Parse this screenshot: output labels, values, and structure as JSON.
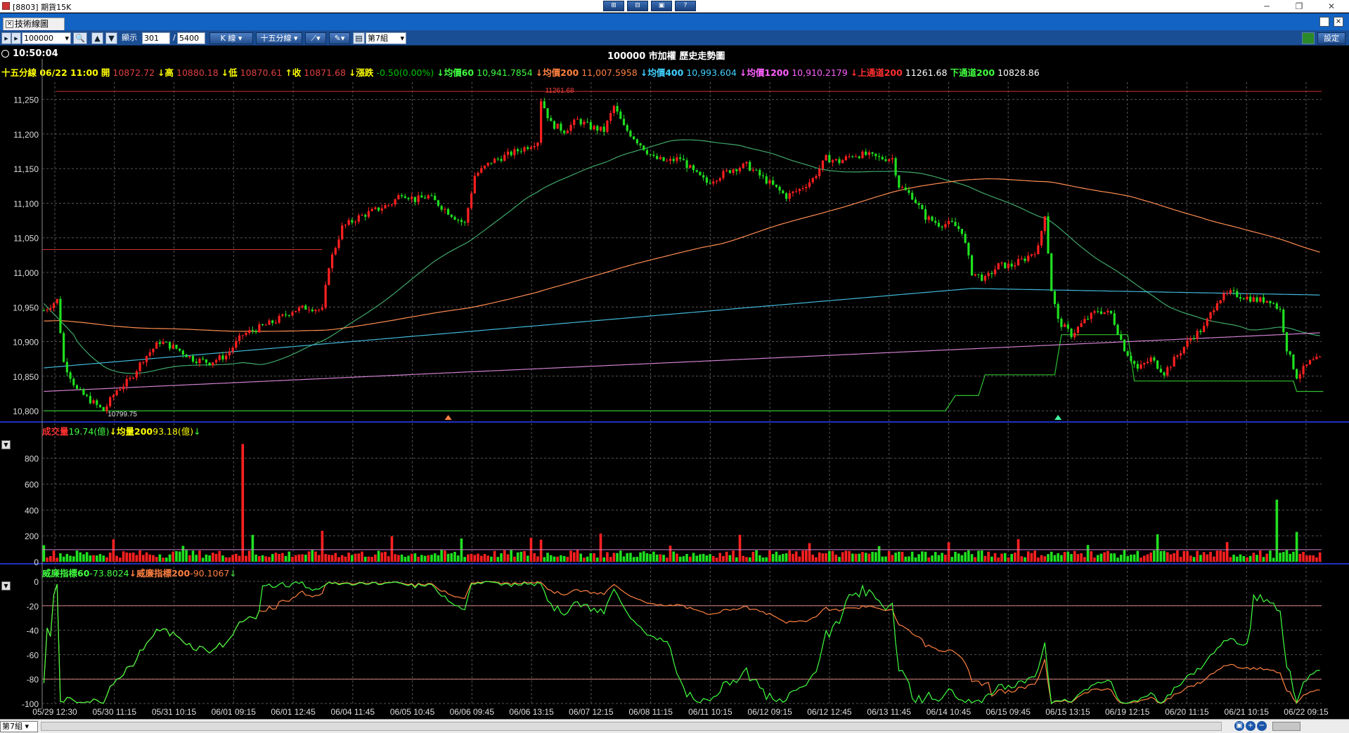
{
  "window": {
    "title": "[8803] 期貨15K",
    "toolbar_buttons": [
      "⊞",
      "⊟",
      "▣",
      "?"
    ],
    "min": "─",
    "restore": "❐",
    "close": "✕"
  },
  "tab": {
    "label": "技術線圖"
  },
  "toolbar": {
    "symbol": "100000",
    "display_label": "顯示",
    "display_count": "301",
    "slash": "/",
    "total_count": "5400",
    "kline": "K 線",
    "period": "十五分線",
    "group": "第7組",
    "settings": "設定"
  },
  "header": {
    "time": "10:50:04",
    "title": "100000 市加權   歷史走勢圖"
  },
  "info": [
    {
      "text": "十五分線 06/22 11:00",
      "color": "#ffff00",
      "bold": true
    },
    {
      "text": "開",
      "color": "#ffff00",
      "bold": true
    },
    {
      "text": "10872.72",
      "color": "#e04040"
    },
    {
      "text": "↓高",
      "color": "#ffff00",
      "bold": true
    },
    {
      "text": "10880.18",
      "color": "#e04040"
    },
    {
      "text": "↓低",
      "color": "#ffff00",
      "bold": true
    },
    {
      "text": "10870.61",
      "color": "#e04040"
    },
    {
      "text": "↑收",
      "color": "#ffff00",
      "bold": true
    },
    {
      "text": "10871.68",
      "color": "#e04040"
    },
    {
      "text": "↓漲跌",
      "color": "#ffff00",
      "bold": true
    },
    {
      "text": "-0.50(0.00%)",
      "color": "#00c800"
    },
    {
      "text": "↓均價60",
      "color": "#40ff40",
      "bold": true
    },
    {
      "text": "10,941.7854",
      "color": "#40ff40"
    },
    {
      "text": "↓均價200",
      "color": "#ff8040",
      "bold": true
    },
    {
      "text": "11,007.5958",
      "color": "#ff8040"
    },
    {
      "text": "↓均價400",
      "color": "#40d0ff",
      "bold": true
    },
    {
      "text": "10,993.604",
      "color": "#40d0ff"
    },
    {
      "text": "↓均價1200",
      "color": "#ff60ff",
      "bold": true
    },
    {
      "text": "10,910.2179",
      "color": "#ff60ff"
    },
    {
      "text": "↓上通道200",
      "color": "#ff3030",
      "bold": true
    },
    {
      "text": "11261.68",
      "color": "#ffffff"
    },
    {
      "text": "下通道200",
      "color": "#40ff40",
      "bold": true
    },
    {
      "text": "10828.86",
      "color": "#ffffff"
    }
  ],
  "volume_header": [
    {
      "text": "成交量",
      "color": "#ff3030",
      "bold": true
    },
    {
      "text": "19.74(億)",
      "color": "#40ff40"
    },
    {
      "text": "↓均量200",
      "color": "#ffff00",
      "bold": true
    },
    {
      "text": "93.18(億)",
      "color": "#ffff00"
    },
    {
      "text": "↓",
      "color": "#40ff40"
    }
  ],
  "williams_header": [
    {
      "text": "威廉指標60",
      "color": "#40ff40",
      "bold": true
    },
    {
      "text": "-73.8024",
      "color": "#40ff40"
    },
    {
      "text": "↓威廉指標200",
      "color": "#ff8040",
      "bold": true
    },
    {
      "text": "-90.1067",
      "color": "#ff8040"
    },
    {
      "text": "↓",
      "color": "#40ff40"
    }
  ],
  "chart_data": {
    "type": "candlestick",
    "price_axis": {
      "ticks": [
        "11,250",
        "11,200",
        "11,150",
        "11,100",
        "11,050",
        "11,000",
        "10,950",
        "10,900",
        "10,850",
        "10,800"
      ],
      "ylim": [
        10795,
        11275
      ]
    },
    "volume_axis": {
      "ticks": [
        "800",
        "600",
        "400",
        "200",
        "0"
      ],
      "ylim": [
        0,
        950
      ]
    },
    "williams_axis": {
      "ticks": [
        "0",
        "-20",
        "-40",
        "-60",
        "-80",
        "-100"
      ],
      "ylim": [
        -100,
        0
      ]
    },
    "x_ticks": [
      "05/29 12:30",
      "05/30 11:15",
      "05/31 10:15",
      "06/01 09:15",
      "06/01 12:45",
      "06/04 11:45",
      "06/05 10:45",
      "06/06 09:45",
      "06/06 13:15",
      "06/07 12:15",
      "06/08 11:15",
      "06/11 10:15",
      "06/12 09:15",
      "06/12 12:45",
      "06/13 11:45",
      "06/14 10:45",
      "06/15 09:45",
      "06/15 13:15",
      "06/19 12:15",
      "06/20 11:15",
      "06/21 10:15",
      "06/22 09:15"
    ],
    "annotations": {
      "high": "11261.68",
      "low": "10799.75"
    },
    "anchors": [
      [
        0,
        10945
      ],
      [
        4,
        10960
      ],
      [
        6,
        10870
      ],
      [
        10,
        10830
      ],
      [
        14,
        10815
      ],
      [
        18,
        10800
      ],
      [
        22,
        10830
      ],
      [
        26,
        10845
      ],
      [
        30,
        10875
      ],
      [
        35,
        10900
      ],
      [
        40,
        10890
      ],
      [
        45,
        10875
      ],
      [
        50,
        10870
      ],
      [
        55,
        10880
      ],
      [
        60,
        10910
      ],
      [
        65,
        10920
      ],
      [
        70,
        10930
      ],
      [
        75,
        10945
      ],
      [
        80,
        10950
      ],
      [
        84,
        10945
      ],
      [
        86,
        11010
      ],
      [
        90,
        11065
      ],
      [
        95,
        11080
      ],
      [
        100,
        11090
      ],
      [
        105,
        11100
      ],
      [
        108,
        11115
      ],
      [
        112,
        11105
      ],
      [
        116,
        11110
      ],
      [
        120,
        11095
      ],
      [
        124,
        11080
      ],
      [
        127,
        11070
      ],
      [
        130,
        11140
      ],
      [
        135,
        11160
      ],
      [
        140,
        11170
      ],
      [
        145,
        11180
      ],
      [
        149,
        11190
      ],
      [
        150,
        11250
      ],
      [
        153,
        11215
      ],
      [
        157,
        11205
      ],
      [
        161,
        11220
      ],
      [
        165,
        11210
      ],
      [
        169,
        11205
      ],
      [
        172,
        11240
      ],
      [
        175,
        11210
      ],
      [
        180,
        11185
      ],
      [
        184,
        11165
      ],
      [
        188,
        11160
      ],
      [
        192,
        11165
      ],
      [
        196,
        11145
      ],
      [
        200,
        11130
      ],
      [
        204,
        11140
      ],
      [
        208,
        11150
      ],
      [
        212,
        11155
      ],
      [
        216,
        11140
      ],
      [
        220,
        11125
      ],
      [
        224,
        11110
      ],
      [
        228,
        11120
      ],
      [
        232,
        11135
      ],
      [
        236,
        11165
      ],
      [
        240,
        11160
      ],
      [
        244,
        11170
      ],
      [
        248,
        11170
      ],
      [
        252,
        11165
      ],
      [
        256,
        11165
      ],
      [
        258,
        11125
      ],
      [
        262,
        11110
      ],
      [
        266,
        11080
      ],
      [
        270,
        11070
      ],
      [
        274,
        11070
      ],
      [
        277,
        11060
      ],
      [
        280,
        11000
      ],
      [
        284,
        10990
      ],
      [
        288,
        11010
      ],
      [
        292,
        11010
      ],
      [
        296,
        11020
      ],
      [
        300,
        11035
      ],
      [
        302,
        11085
      ],
      [
        304,
        10975
      ],
      [
        306,
        10930
      ],
      [
        310,
        10910
      ],
      [
        314,
        10930
      ],
      [
        318,
        10945
      ],
      [
        322,
        10940
      ],
      [
        326,
        10890
      ],
      [
        330,
        10860
      ],
      [
        334,
        10875
      ],
      [
        338,
        10855
      ],
      [
        342,
        10880
      ],
      [
        346,
        10905
      ],
      [
        350,
        10920
      ],
      [
        354,
        10960
      ],
      [
        358,
        10970
      ],
      [
        362,
        10965
      ],
      [
        366,
        10960
      ],
      [
        370,
        10960
      ],
      [
        373,
        10945
      ],
      [
        375,
        10890
      ],
      [
        378,
        10850
      ],
      [
        382,
        10870
      ],
      [
        385,
        10875
      ]
    ],
    "lower_channel_steps": [
      [
        0,
        10800
      ],
      [
        272,
        10800
      ],
      [
        275,
        10822
      ],
      [
        282,
        10822
      ],
      [
        284,
        10852
      ],
      [
        305,
        10852
      ],
      [
        307,
        10910
      ],
      [
        327,
        10910
      ],
      [
        329,
        10843
      ],
      [
        377,
        10843
      ],
      [
        378,
        10828
      ],
      [
        386,
        10828
      ]
    ],
    "upper_channel": 11261.68,
    "spikes": [
      [
        60,
        910
      ],
      [
        372,
        480
      ],
      [
        150,
        170
      ]
    ]
  }
}
